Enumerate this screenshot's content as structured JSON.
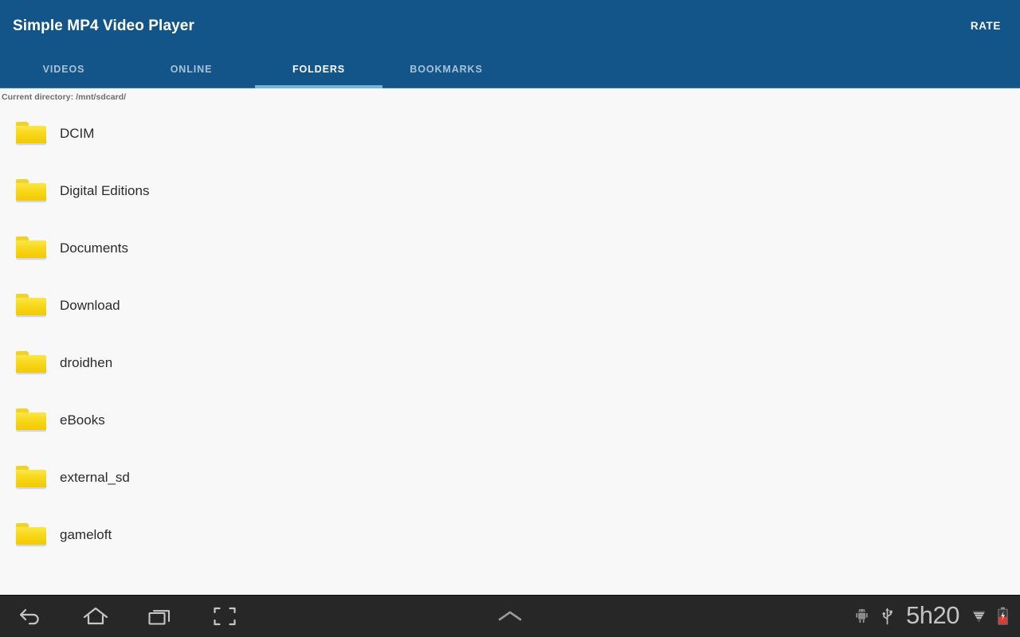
{
  "actionbar": {
    "title": "Simple MP4 Video Player",
    "rate_label": "RATE",
    "background_color": "#135589",
    "title_color": "#ffffff"
  },
  "tabs": {
    "active_index": 2,
    "indicator_color": "#73b5e0",
    "inactive_color": "#a7c2d8",
    "items": [
      {
        "label": "VIDEOS",
        "name": "tab-videos"
      },
      {
        "label": "ONLINE",
        "name": "tab-online"
      },
      {
        "label": "FOLDERS",
        "name": "tab-folders"
      },
      {
        "label": "BOOKMARKS",
        "name": "tab-bookmarks"
      }
    ]
  },
  "content": {
    "current_directory_label": "Current directory: /mnt/sdcard/",
    "background_color": "#f8f8f8",
    "folder_icon_color": "#f5d61f",
    "folders": [
      {
        "name": "DCIM",
        "icon": "folder-icon"
      },
      {
        "name": "Digital Editions",
        "icon": "folder-icon"
      },
      {
        "name": "Documents",
        "icon": "folder-icon"
      },
      {
        "name": "Download",
        "icon": "folder-icon"
      },
      {
        "name": "droidhen",
        "icon": "folder-icon"
      },
      {
        "name": "eBooks",
        "icon": "folder-icon"
      },
      {
        "name": "external_sd",
        "icon": "folder-icon"
      },
      {
        "name": "gameloft",
        "icon": "folder-icon"
      }
    ]
  },
  "navbar": {
    "background_color": "#272727",
    "buttons": [
      {
        "name": "back-icon",
        "label": "Back"
      },
      {
        "name": "home-icon",
        "label": "Home"
      },
      {
        "name": "recents-icon",
        "label": "Recent apps"
      },
      {
        "name": "screenshot-icon",
        "label": "Screenshot"
      }
    ],
    "center_button": {
      "name": "chevron-up-icon",
      "label": "Show navigation"
    },
    "status": {
      "android_icon": "android-robot-icon",
      "usb_icon": "usb-icon",
      "clock": "5h20",
      "signal_icon": "signal-bars-icon",
      "battery_icon": "battery-charging-icon",
      "battery_color": "#e03a2f",
      "clock_color": "#c3c3c3"
    }
  }
}
